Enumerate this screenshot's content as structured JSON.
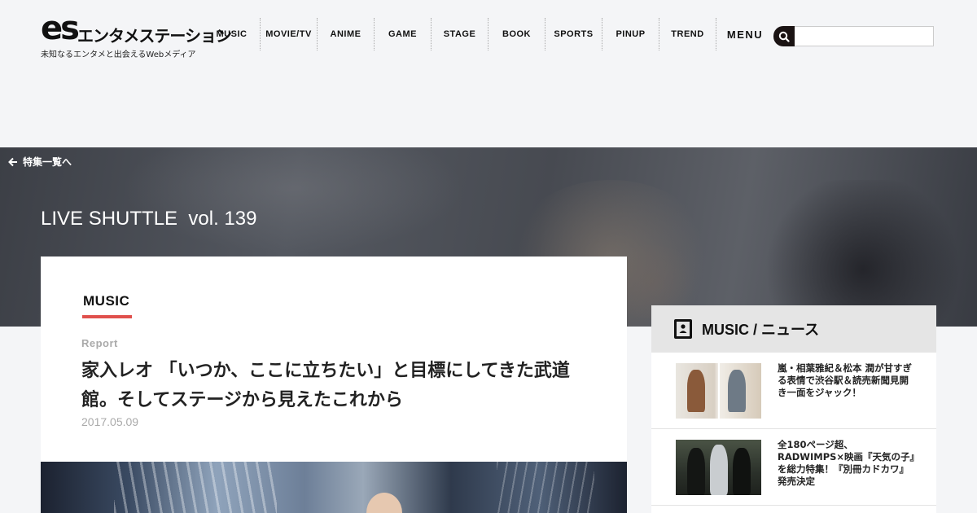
{
  "header": {
    "logo_mark": "es",
    "logo_text": "エンタメステーション",
    "tagline": "未知なるエンタメと出会えるWebメディア",
    "nav": [
      "MUSIC",
      "MOVIE/TV",
      "ANIME",
      "GAME",
      "STAGE",
      "BOOK",
      "SPORTS",
      "PINUP",
      "TREND",
      "MENU"
    ],
    "search": {
      "placeholder": "",
      "icon": "search-icon"
    }
  },
  "hero": {
    "back_label": "特集一覧へ",
    "back_icon": "arrow-left-icon",
    "title": "LIVE SHUTTLE  vol. 139"
  },
  "article": {
    "category": "MUSIC",
    "category_color": "#e0504c",
    "type": "Report",
    "title": "家入レオ 「いつか、ここに立ちたい」と目標にしてきた武道館。そしてステージから見えたこれから",
    "date": "2017.05.09"
  },
  "sidebar": {
    "title": "MUSIC / ニュース",
    "icon": "news-icon",
    "items": [
      {
        "text": "嵐・相葉雅紀＆松本 潤が甘すぎる表情で渋谷駅＆読売新聞見開き一面をジャック！"
      },
      {
        "text": "全180ページ超、RADWIMPS×映画『天気の子』を総力特集！『別冊カドカワ』発売決定"
      }
    ]
  }
}
